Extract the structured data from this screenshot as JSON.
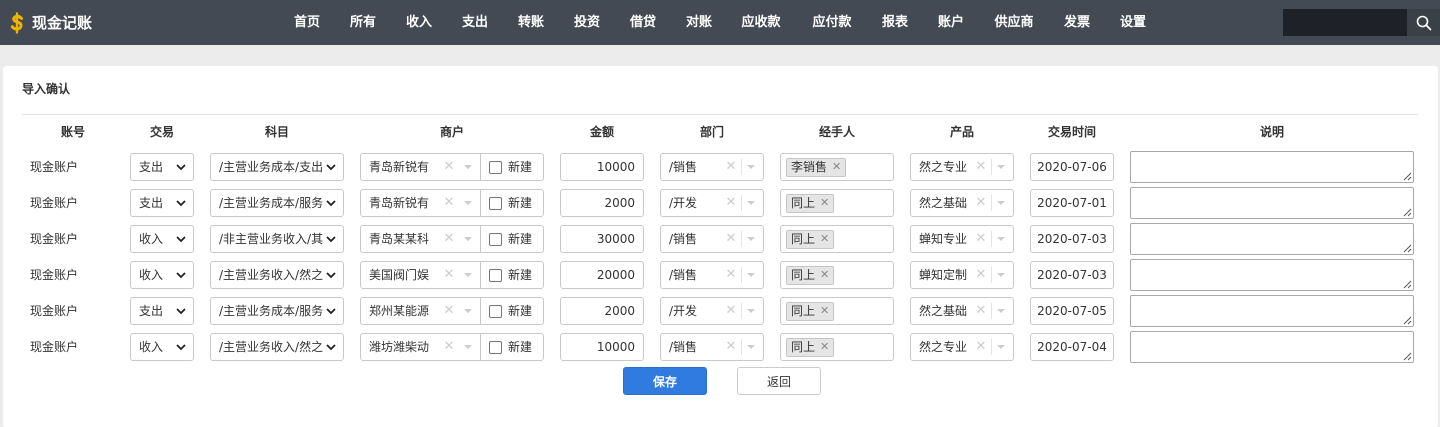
{
  "app": {
    "brand_glyph": "$",
    "title": "现金记账"
  },
  "nav": [
    {
      "label": "首页"
    },
    {
      "label": "所有"
    },
    {
      "label": "收入"
    },
    {
      "label": "支出"
    },
    {
      "label": "转账"
    },
    {
      "label": "投资"
    },
    {
      "label": "借贷"
    },
    {
      "label": "对账"
    },
    {
      "label": "应收款"
    },
    {
      "label": "应付款"
    },
    {
      "label": "报表"
    },
    {
      "label": "账户"
    },
    {
      "label": "供应商"
    },
    {
      "label": "发票"
    },
    {
      "label": "设置"
    }
  ],
  "search": {
    "value": ""
  },
  "panel": {
    "title": "导入确认"
  },
  "columns": {
    "account": "账号",
    "type": "交易",
    "subject": "科目",
    "merchant": "商户",
    "amount": "金额",
    "dept": "部门",
    "handler": "经手人",
    "product": "产品",
    "time": "交易时间",
    "desc": "说明"
  },
  "new_label": "新建",
  "rows": [
    {
      "account": "现金账户",
      "type": "支出",
      "subject": "/主营业务成本/支出",
      "merchant": "青岛新锐有",
      "amount": "10000",
      "dept": "/销售",
      "handler": "李销售",
      "product": "然之专业",
      "date": "2020-07-06",
      "desc": ""
    },
    {
      "account": "现金账户",
      "type": "支出",
      "subject": "/主营业务成本/服务",
      "merchant": "青岛新锐有",
      "amount": "2000",
      "dept": "/开发",
      "handler": "同上",
      "product": "然之基础",
      "date": "2020-07-01",
      "desc": ""
    },
    {
      "account": "现金账户",
      "type": "收入",
      "subject": "/非主营业务收入/其",
      "merchant": "青岛某某科",
      "amount": "30000",
      "dept": "/销售",
      "handler": "同上",
      "product": "蝉知专业",
      "date": "2020-07-03",
      "desc": ""
    },
    {
      "account": "现金账户",
      "type": "收入",
      "subject": "/主营业务收入/然之",
      "merchant": "美国阀门娱",
      "amount": "20000",
      "dept": "/销售",
      "handler": "同上",
      "product": "蝉知定制",
      "date": "2020-07-03",
      "desc": ""
    },
    {
      "account": "现金账户",
      "type": "支出",
      "subject": "/主营业务成本/服务",
      "merchant": "郑州某能源",
      "amount": "2000",
      "dept": "/开发",
      "handler": "同上",
      "product": "然之基础",
      "date": "2020-07-05",
      "desc": ""
    },
    {
      "account": "现金账户",
      "type": "收入",
      "subject": "/主营业务收入/然之",
      "merchant": "潍坊潍柴动",
      "amount": "10000",
      "dept": "/销售",
      "handler": "同上",
      "product": "然之专业",
      "date": "2020-07-04",
      "desc": ""
    }
  ],
  "buttons": {
    "save": "保存",
    "back": "返回"
  },
  "colors": {
    "navbar": "#434a54",
    "brand_icon": "#f0b400",
    "primary": "#2f7be0"
  },
  "icons": {
    "brand": "dollar-icon",
    "search": "search-icon",
    "caret": "chevron-down-icon",
    "clear": "close-icon"
  }
}
